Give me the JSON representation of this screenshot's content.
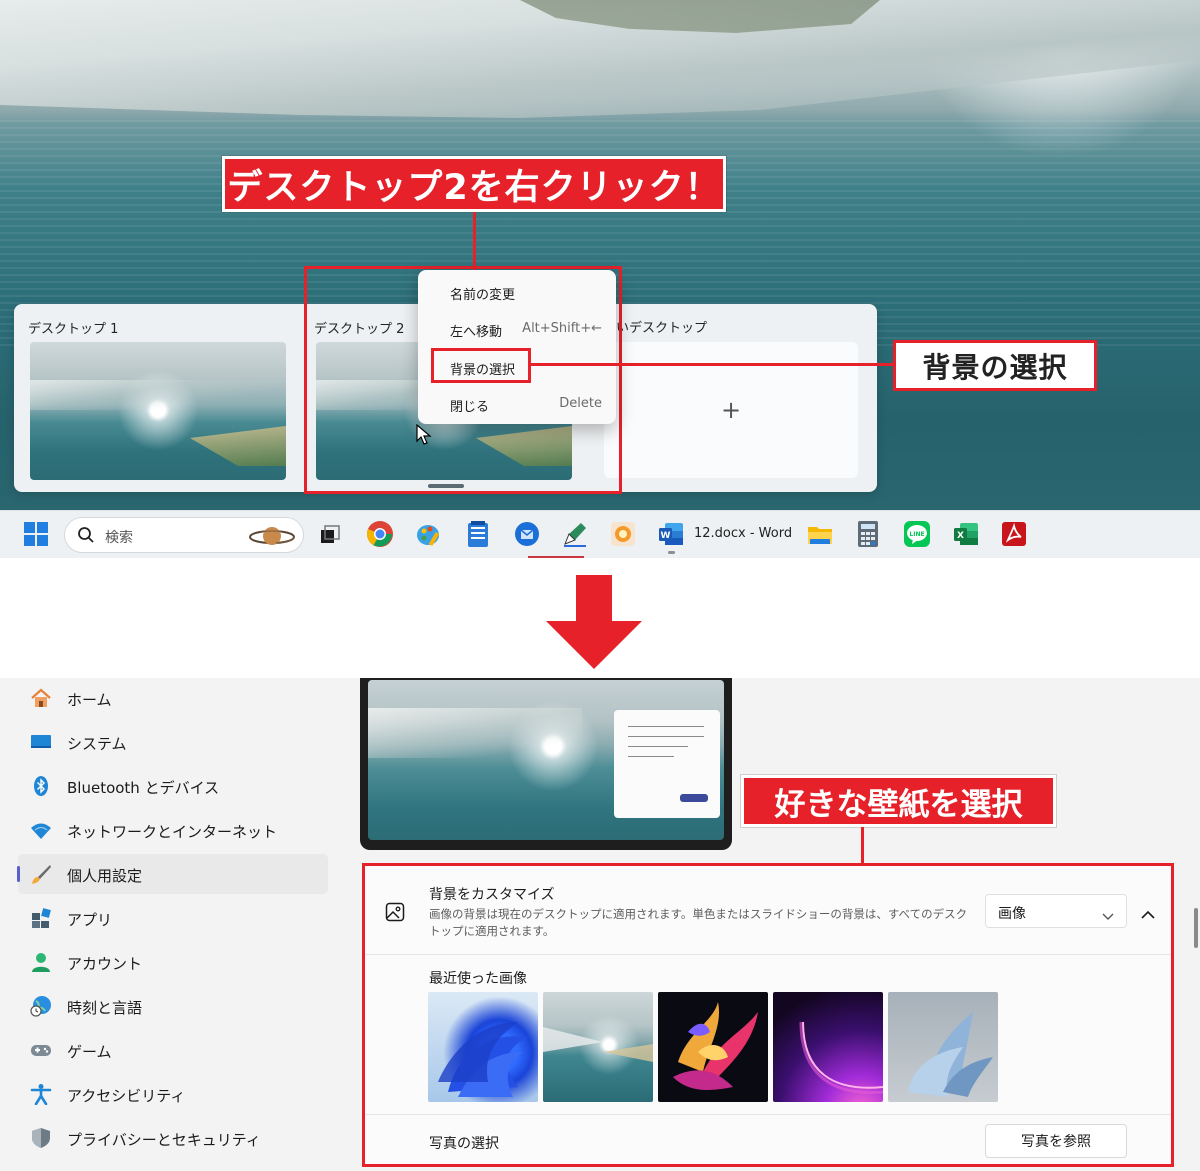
{
  "callouts": {
    "right_click": "デスクトップ2を右クリック！",
    "background_select": "背景の選択",
    "choose_wallpaper": "好きな壁紙を選択"
  },
  "task_view": {
    "desktops": [
      {
        "title": "デスクトップ 1"
      },
      {
        "title": "デスクトップ 2"
      }
    ],
    "new_desktop_title": "いデスクトップ",
    "new_desktop_plus": "+"
  },
  "context_menu": {
    "items": [
      {
        "label": "名前の変更",
        "shortcut": ""
      },
      {
        "label": "左へ移動",
        "shortcut": "Alt+Shift+←"
      },
      {
        "label": "背景の選択",
        "shortcut": ""
      },
      {
        "label": "閉じる",
        "shortcut": "Delete"
      }
    ]
  },
  "taskbar": {
    "search_placeholder": "検索",
    "word_label": "12.docx - Word",
    "icons": [
      "start-icon",
      "task-view-icon",
      "chrome-icon",
      "paint-icon",
      "notepad-icon",
      "thunderbird-icon",
      "pen-app-icon",
      "photo-app-icon",
      "word-icon",
      "file-explorer-icon",
      "calculator-icon",
      "line-icon",
      "excel-icon",
      "acrobat-icon"
    ]
  },
  "sidebar": {
    "items": [
      {
        "label": "ホーム",
        "icon": "home-icon"
      },
      {
        "label": "システム",
        "icon": "system-icon"
      },
      {
        "label": "Bluetooth とデバイス",
        "icon": "bluetooth-icon"
      },
      {
        "label": "ネットワークとインターネット",
        "icon": "wifi-icon"
      },
      {
        "label": "個人用設定",
        "icon": "brush-icon",
        "active": true
      },
      {
        "label": "アプリ",
        "icon": "apps-icon"
      },
      {
        "label": "アカウント",
        "icon": "account-icon"
      },
      {
        "label": "時刻と言語",
        "icon": "globe-clock-icon"
      },
      {
        "label": "ゲーム",
        "icon": "gamepad-icon"
      },
      {
        "label": "アクセシビリティ",
        "icon": "accessibility-icon"
      },
      {
        "label": "プライバシーとセキュリティ",
        "icon": "shield-icon"
      }
    ]
  },
  "background": {
    "title": "背景をカスタマイズ",
    "description": "画像の背景は現在のデスクトップに適用されます。単色またはスライドショーの背景は、すべてのデスクトップに適用されます。",
    "type_value": "画像",
    "recent_title": "最近使った画像",
    "photo_title": "写真の選択",
    "browse_label": "写真を参照"
  },
  "colors": {
    "accent_red": "#e6212a",
    "selection_bar": "#5a5fcf",
    "sidebar_bg": "#f3f3f3"
  }
}
